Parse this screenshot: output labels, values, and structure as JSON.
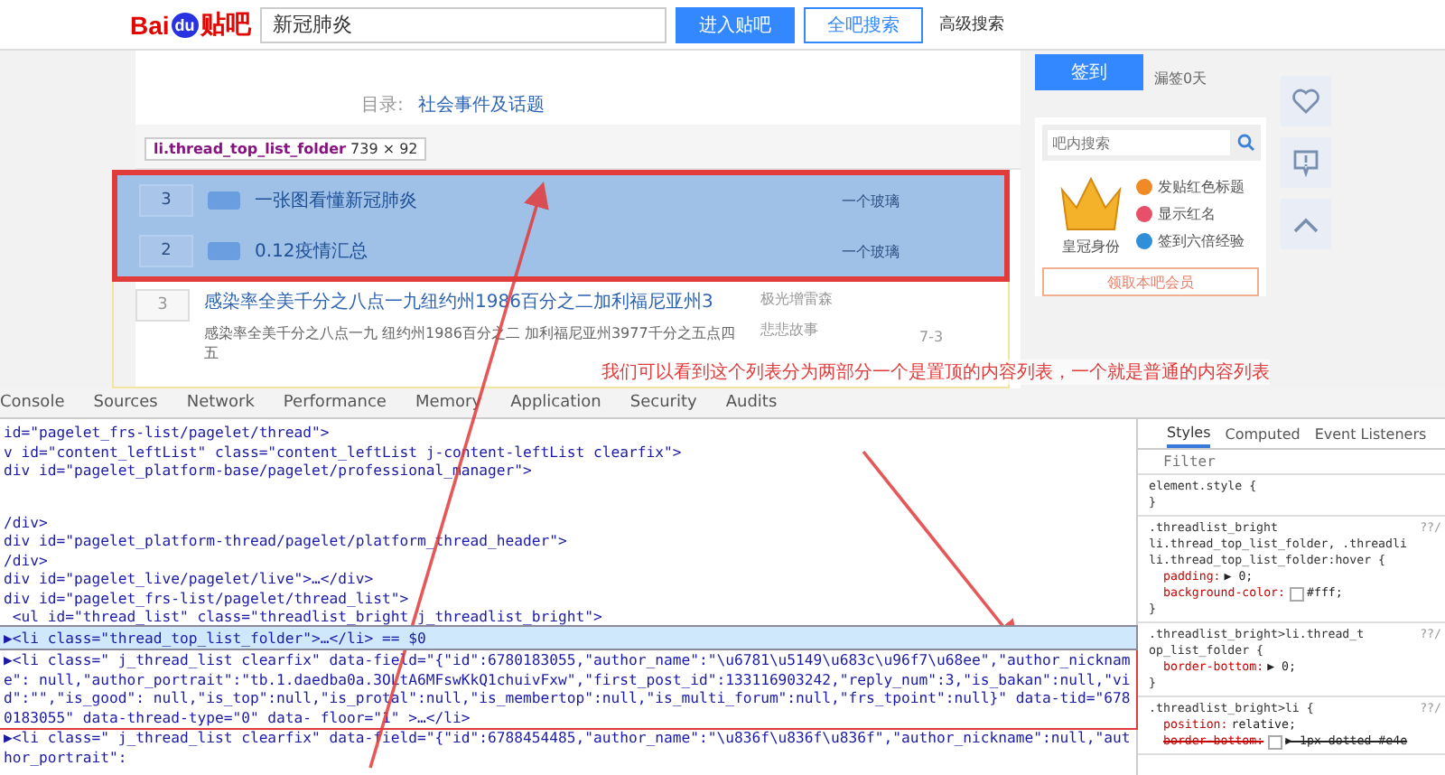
{
  "header": {
    "logo_text": "Bai",
    "logo_badge": "du",
    "logo_suffix": "贴吧",
    "search_value": "新冠肺炎",
    "buttons": [
      {
        "label": "进入贴吧",
        "kind": "primary"
      },
      {
        "label": "全吧搜索",
        "kind": "outline"
      }
    ],
    "link": "高级搜索"
  },
  "forum": {
    "catalog_label": "目录:",
    "catalog_value": "社会事件及话题",
    "sign_button": "签到",
    "sign_status": "漏签0天"
  },
  "inspect_tooltip": {
    "selector": "li.thread_top_list_folder",
    "size": "739 × 92"
  },
  "top_threads": [
    {
      "index": "3",
      "title": "一张图看懂新冠肺炎",
      "author": "一个玻璃"
    },
    {
      "index": "2",
      "title": "0.12疫情汇总",
      "author": "一个玻璃"
    }
  ],
  "threads": [
    {
      "index": "3",
      "title": "感染率全美千分之八点一九纽约州1986百分之二加利福尼亚州3",
      "author": "极光增雷森",
      "excerpt": "感染率全美千分之八点一九 纽约州1986百分之二 加利福尼亚州3977千分之五点四五",
      "last_replier": "悲悲故事",
      "time": "7-3"
    }
  ],
  "annotation": "我们可以看到这个列表分为两部分一个是置顶的内容列表，一个就是普通的内容列表",
  "sidebar": {
    "search_placeholder": "吧内搜索",
    "crown_label": "皇冠身份",
    "perks": [
      {
        "label": "发贴红色标题",
        "color": "#f08a24"
      },
      {
        "label": "显示红名",
        "color": "#e8506a"
      },
      {
        "label": "签到六倍经验",
        "color": "#2f8fd8"
      }
    ],
    "member_button": "领取本吧会员"
  },
  "devtools": {
    "tabs": [
      {
        "label": "Console",
        "selected": false
      },
      {
        "label": "Sources",
        "selected": false
      },
      {
        "label": "Network",
        "selected": false
      },
      {
        "label": "Performance",
        "selected": false
      },
      {
        "label": "Memory",
        "selected": false
      },
      {
        "label": "Application",
        "selected": false
      },
      {
        "label": "Security",
        "selected": false
      },
      {
        "label": "Audits",
        "selected": false
      }
    ],
    "elements": [
      {
        "text": "id=\"pagelet_frs-list/pagelet/thread\">",
        "selected": false,
        "boxed": false
      },
      {
        "text": "v id=\"content_leftList\" class=\"content_leftList j-content-leftList clearfix\">",
        "selected": false,
        "boxed": false
      },
      {
        "text": "div id=\"pagelet_platform-base/pagelet/professional_manager\">",
        "selected": false,
        "boxed": false
      },
      {
        "text": "/div>",
        "selected": false,
        "boxed": false
      },
      {
        "text": "div id=\"pagelet_platform-thread/pagelet/platform_thread_header\">",
        "selected": false,
        "boxed": false
      },
      {
        "text": "/div>",
        "selected": false,
        "boxed": false
      },
      {
        "text": "div id=\"pagelet_live/pagelet/live\">…</div>",
        "selected": false,
        "boxed": false
      },
      {
        "text": "div id=\"pagelet_frs-list/pagelet/thread_list\">",
        "selected": false,
        "boxed": false
      },
      {
        "text": " <ul id=\"thread_list\" class=\"threadlist_bright j_threadlist_bright\">",
        "selected": false,
        "boxed": false
      },
      {
        "text": "▶<li class=\"thread_top_list_folder\">…</li> == $0",
        "selected": true,
        "boxed": true
      },
      {
        "text": "▶<li class=\" j_thread_list clearfix\" data-field=\"{\"id\":6780183055,\"author_name\":\"\\u6781\\u5149\\u683c\\u96f7\\u68ee\",\"author_nickname\": null,\"author_portrait\":\"tb.1.daedba0a.3OLtA6MFswKkQ1chuivFxw\",\"first_post_id\":133116903242,\"reply_num\":3,\"is_bakan\":null,\"vid\":\"\",\"is_good\": null,\"is_top\":null,\"is_protal\":null,\"is_membertop\":null,\"is_multi_forum\":null,\"frs_tpoint\":null}\" data-tid=\"6780183055\" data-thread-type=\"0\" data- floor=\"1\" >…</li>",
        "selected": false,
        "boxed": true
      },
      {
        "text": "▶<li class=\" j_thread_list clearfix\" data-field=\"{\"id\":6788454485,\"author_name\":\"\\u836f\\u836f\\u836f\",\"author_nickname\":null,\"author_portrait\":",
        "selected": false,
        "boxed": false
      }
    ],
    "style_tabs": [
      {
        "label": "Styles",
        "selected": true
      },
      {
        "label": "Computed",
        "selected": false
      },
      {
        "label": "Event Listeners",
        "selected": false
      }
    ],
    "filter_placeholder": "Filter",
    "rules": [
      {
        "selector": [
          "element.style {"
        ],
        "close": "}"
      },
      {
        "selector": [
          ".threadlist_bright",
          "li.thread_top_list_folder, .threadli",
          "li.thread_top_list_folder:hover {"
        ],
        "source": "??/",
        "props": [
          {
            "name": "padding:",
            "value": "▶ 0;",
            "swatch": false,
            "struck": false
          },
          {
            "name": "background-color:",
            "value": "#fff;",
            "swatch": true,
            "struck": false
          }
        ],
        "close": "}"
      },
      {
        "selector": [
          ".threadlist_bright>li.thread_t",
          "op_list_folder {"
        ],
        "source": "??/",
        "props": [
          {
            "name": "border-bottom:",
            "value": "▶ 0;",
            "swatch": false,
            "struck": false
          }
        ],
        "close": "}"
      },
      {
        "selector": [
          ".threadlist_bright>li {"
        ],
        "source": "??/",
        "props": [
          {
            "name": "position:",
            "value": "relative;",
            "swatch": false,
            "struck": false
          },
          {
            "name": "border-bottom:",
            "value": "▶ 1px dotted #e4e",
            "swatch": true,
            "struck": true
          }
        ]
      }
    ]
  }
}
